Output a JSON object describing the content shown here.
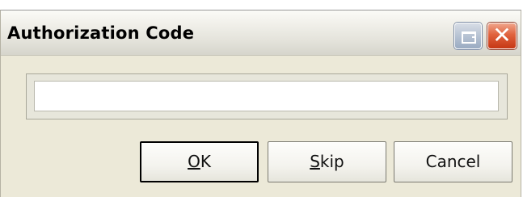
{
  "window": {
    "title": "Authorization Code"
  },
  "titlebar_buttons": {
    "restore_icon": "restore-icon",
    "close_icon": "close-icon",
    "close_glyph": "✕"
  },
  "authorization_input": {
    "value": "",
    "placeholder": ""
  },
  "buttons": {
    "ok": {
      "accel": "O",
      "rest": "K"
    },
    "skip": {
      "accel": "S",
      "rest": "kip"
    },
    "cancel": {
      "label": "Cancel"
    }
  },
  "colors": {
    "window_background": "#ece9d8",
    "close_button": "#d4502b",
    "restore_button": "#b7c3d3"
  }
}
